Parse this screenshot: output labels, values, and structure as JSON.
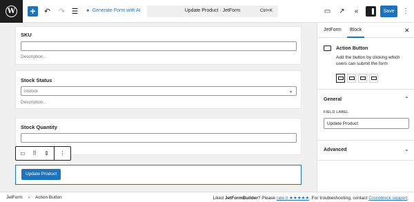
{
  "toolbar": {
    "generate_label": "Generate Form with AI",
    "doc_title": "Update Product · JetForm",
    "shortcut": "Ctrl+K",
    "save_label": "Save"
  },
  "fields": [
    {
      "label": "SKU",
      "value": "",
      "description": "Description..."
    },
    {
      "label": "Stock Status",
      "value": "instock",
      "description": "Description..."
    },
    {
      "label": "Stock Quantity",
      "value": "",
      "description": ""
    }
  ],
  "action": {
    "button_label": "Update Product"
  },
  "sidebar": {
    "tabs": [
      "JetForm",
      "Block"
    ],
    "active_tab": "Block",
    "block_name": "Action Button",
    "block_desc": "Add the button by clicking which users can submit the form",
    "panels": {
      "general": "General",
      "advanced": "Advanced"
    },
    "field_label_caption": "FIELD LABEL",
    "field_label_value": "Update Product"
  },
  "footer": {
    "crumbs": [
      "JetForm",
      "Action Button"
    ],
    "msg_prefix": "Liked ",
    "brand": "JetFormBuilder",
    "msg_mid": "? Please ",
    "rate_link": "rate it ★★★★★",
    "msg_mid2": ". For troubleshooting, contact ",
    "support_link": "Crocoblock support",
    "msg_end": "."
  },
  "colors": {
    "accent": "#1e73be",
    "dark": "#1e1e1e",
    "canvas": "#f0f0f1"
  }
}
